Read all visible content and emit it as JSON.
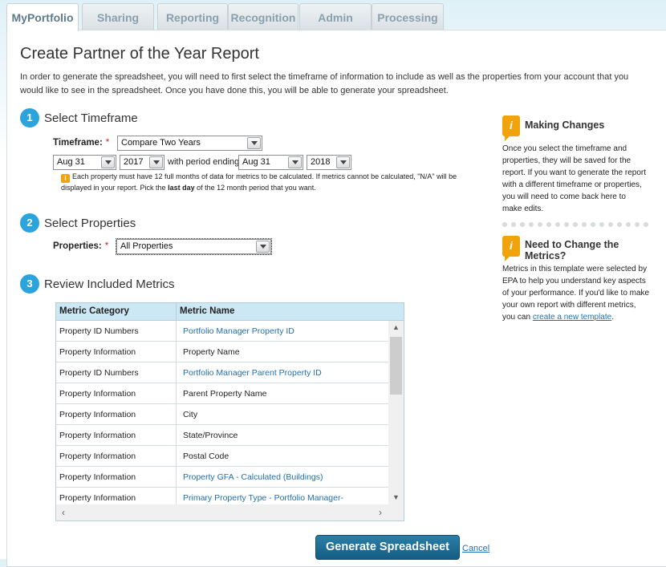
{
  "tabs": [
    "MyPortfolio",
    "Sharing",
    "Reporting",
    "Recognition",
    "Admin",
    "Processing"
  ],
  "page": {
    "title": "Create Partner of the Year Report",
    "intro": "In order to generate the spreadsheet, you will need to first select the timeframe of information to include as well as the properties from your account that you would like to see in the spreadsheet. Once you have done this, you will be able to generate your spreadsheet."
  },
  "steps": {
    "s1": {
      "num": "1",
      "title": "Select Timeframe"
    },
    "s2": {
      "num": "2",
      "title": "Select Properties"
    },
    "s3": {
      "num": "3",
      "title": "Review Included Metrics"
    }
  },
  "timeframe": {
    "label": "Timeframe:",
    "required": "*",
    "value": "Compare Two Years",
    "start_month": "Aug 31",
    "start_year": "2017",
    "period_text": "with period ending",
    "end_month": "Aug 31",
    "end_year": "2018",
    "note_part1": "Each property must have 12 full months of data for metrics to be calculated. If metrics cannot be calculated, \"N/A\" will be displayed in your report. Pick the ",
    "note_bold": "last day",
    "note_part2": " of the 12 month period that you want."
  },
  "properties": {
    "label": "Properties:",
    "required": "*",
    "value": "All Properties"
  },
  "metrics_table": {
    "headers": [
      "Metric Category",
      "Metric Name"
    ],
    "rows": [
      {
        "category": "Property ID Numbers",
        "name": "Portfolio Manager Property ID",
        "link": true
      },
      {
        "category": "Property Information",
        "name": "Property Name",
        "link": false
      },
      {
        "category": "Property ID Numbers",
        "name": "Portfolio Manager Parent Property ID",
        "link": true
      },
      {
        "category": "Property Information",
        "name": "Parent Property Name",
        "link": false
      },
      {
        "category": "Property Information",
        "name": "City",
        "link": false
      },
      {
        "category": "Property Information",
        "name": "State/Province",
        "link": false
      },
      {
        "category": "Property Information",
        "name": "Postal Code",
        "link": false
      },
      {
        "category": "Property Information",
        "name": "Property GFA - Calculated (Buildings)",
        "link": true
      },
      {
        "category": "Property Information",
        "name": "Primary Property Type - Portfolio Manager-",
        "link": true
      }
    ]
  },
  "sidebar": {
    "box1": {
      "title": "Making Changes",
      "text": "Once you select the timeframe and properties, they will be saved for the report. If you want to generate the report with a different timeframe or properties, you will need to come back here to make edits."
    },
    "box2": {
      "title": "Need to Change the Metrics?",
      "text": "Metrics in this template were selected by EPA to help you understand key aspects of your performance. If you'd like to make your own report with different metrics, you can ",
      "link": "create a new template",
      "end": "."
    }
  },
  "actions": {
    "generate": "Generate Spreadsheet",
    "cancel": "Cancel"
  },
  "colors": {
    "accent": "#2ba3dc",
    "button": "#155c84",
    "link": "#1f6fb2",
    "info_icon": "#f0a30a"
  }
}
